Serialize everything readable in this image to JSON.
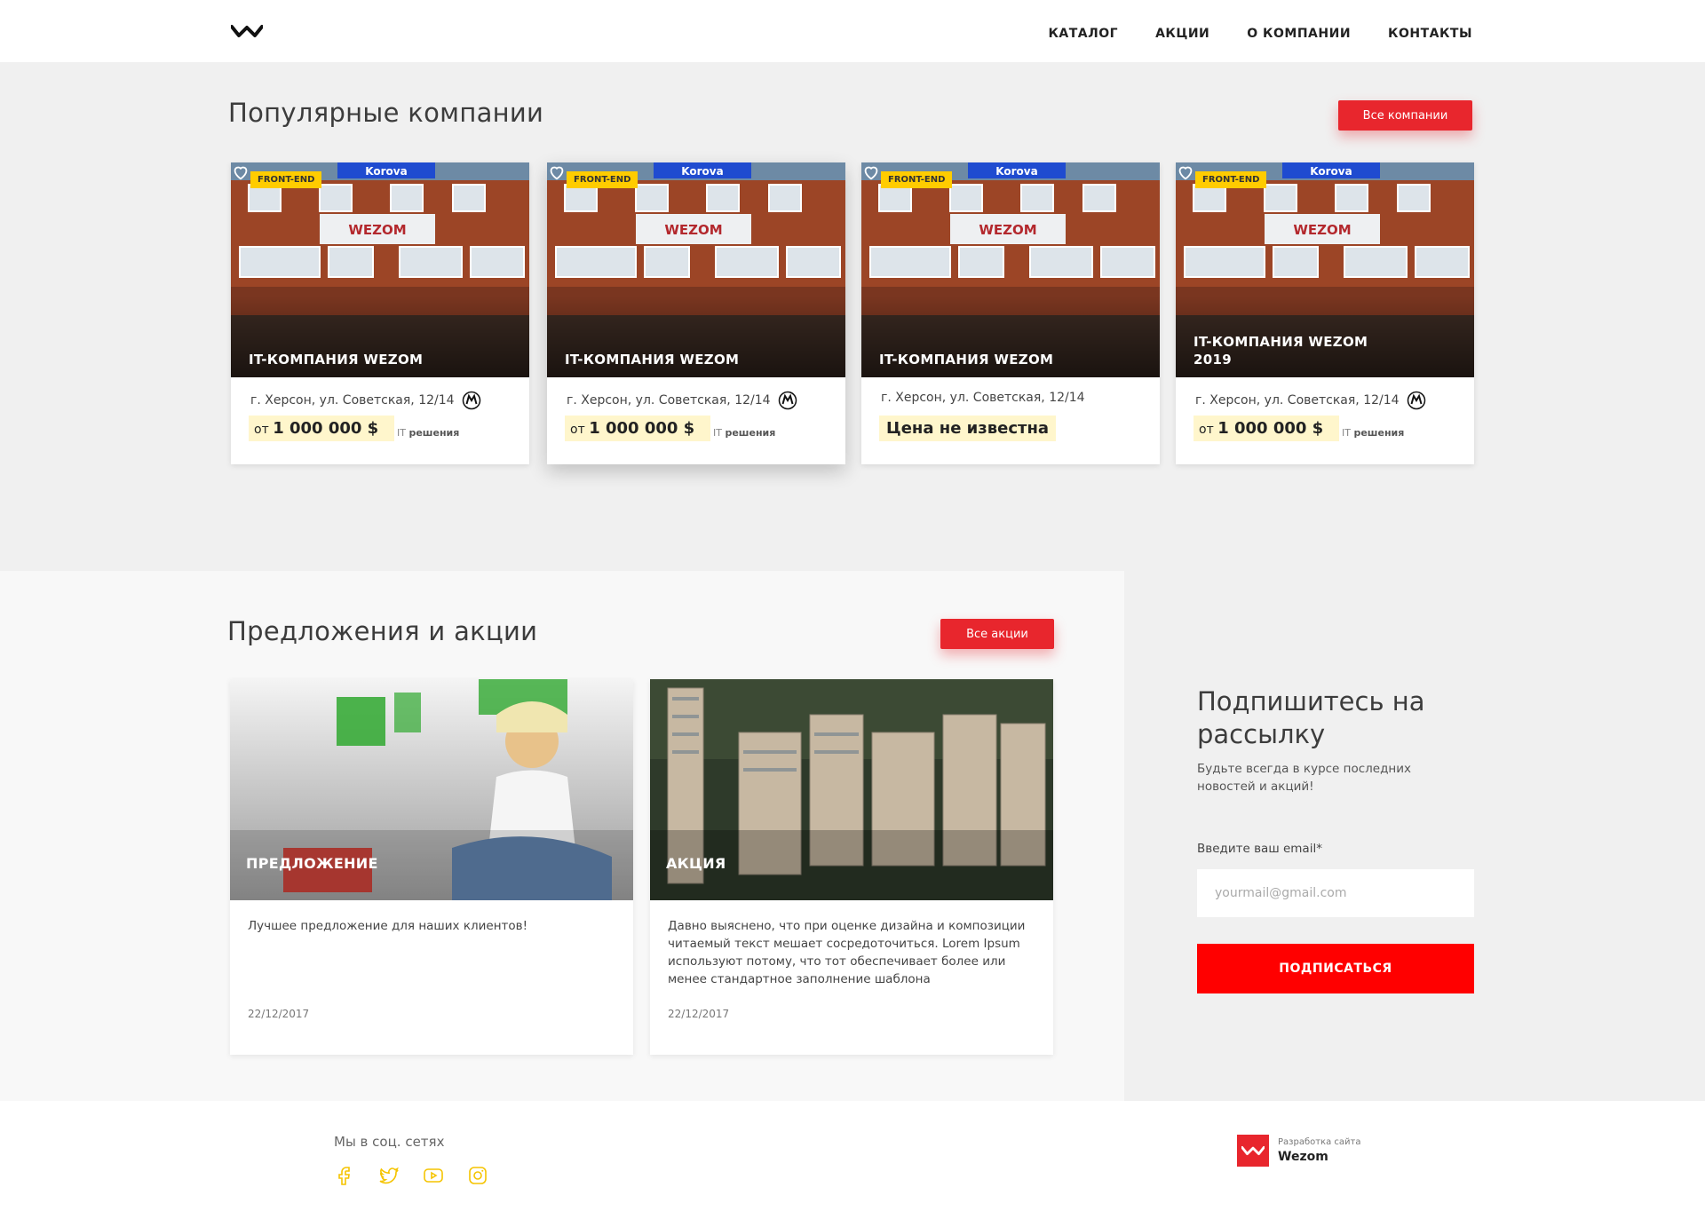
{
  "header": {
    "nav": [
      "КАТАЛОГ",
      "АКЦИИ",
      "О КОМПАНИИ",
      "КОНТАКТЫ"
    ]
  },
  "popular": {
    "title": "Популярные компании",
    "all_button": "Все компании",
    "cards": [
      {
        "badge": "FRONT-END",
        "title": "IT-КОМПАНИЯ WEZOM",
        "address": "г. Херсон, ул. Советская, 12/14",
        "metro": true,
        "price_prefix": "от",
        "price": "1 000 000 $",
        "category_prefix": "IT",
        "category": "решения"
      },
      {
        "badge": "FRONT-END",
        "title": "IT-КОМПАНИЯ WEZOM",
        "address": "г. Херсон, ул. Советская, 12/14",
        "metro": true,
        "price_prefix": "от",
        "price": "1 000 000 $",
        "category_prefix": "IT",
        "category": "решения"
      },
      {
        "badge": "FRONT-END",
        "title": "IT-КОМПАНИЯ WEZOM",
        "address": "г. Херсон, ул. Советская, 12/14",
        "metro": false,
        "price_text": "Цена не известна"
      },
      {
        "badge": "FRONT-END",
        "title": "IT-КОМПАНИЯ WEZOM 2019",
        "address": "г. Херсон, ул. Советская, 12/14",
        "metro": true,
        "price_prefix": "от",
        "price": "1 000 000 $",
        "category_prefix": "IT",
        "category": "решения"
      }
    ],
    "building_sign": "WEZOM",
    "banner_text": "Korova"
  },
  "offers": {
    "title": "Предложения и акции",
    "all_button": "Все акции",
    "cards": [
      {
        "tag": "ПРЕДЛОЖЕНИЕ",
        "text": "Лучшее предложение для наших клиентов!",
        "date": "22/12/2017"
      },
      {
        "tag": "АКЦИЯ",
        "text": "Давно выяснено, что при оценке дизайна и композиции читаемый текст мешает сосредоточиться. Lorem Ipsum используют потому, что тот обеспечивает более или менее стандартное заполнение шаблона",
        "date": "22/12/2017"
      }
    ]
  },
  "subscribe": {
    "title": "Подпишитесь на рассылку",
    "text": "Будьте всегда в курсе последних новостей и акций!",
    "label": "Введите ваш email*",
    "placeholder": "yourmail@gmail.com",
    "button": "ПОДПИСАТЬСЯ"
  },
  "footer": {
    "social_title": "Мы в соц. сетях",
    "social_icons": [
      "facebook-icon",
      "twitter-icon",
      "youtube-icon",
      "instagram-icon"
    ],
    "dev_small": "Разработка сайта",
    "dev_name": "Wezom"
  },
  "colors": {
    "accent": "#e8262d",
    "badge": "#ffcc00",
    "social": "#f5c400",
    "subscribe_button": "#ff0000"
  }
}
